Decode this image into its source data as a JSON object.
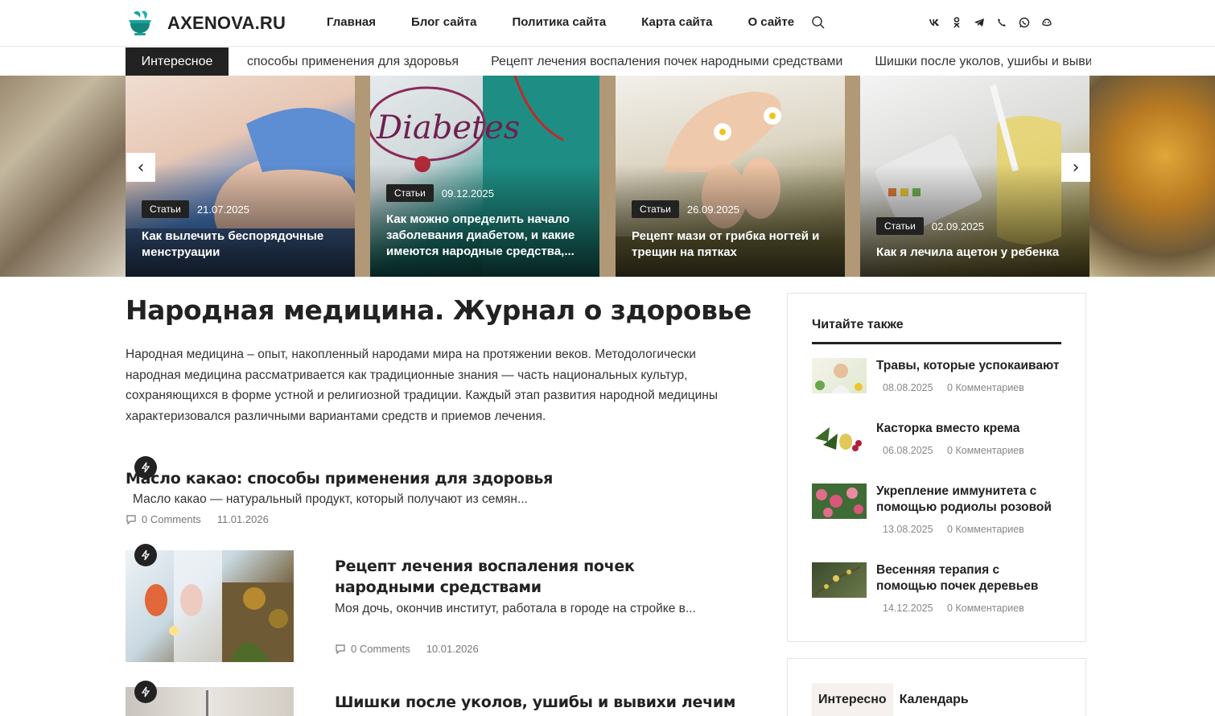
{
  "header": {
    "logo_text": "AXENOVA.RU",
    "nav": [
      "Главная",
      "Блог сайта",
      "Политика сайта",
      "Карта сайта",
      "О сайте"
    ],
    "social_icons": [
      "vk-icon",
      "odnoklassniki-icon",
      "telegram-icon",
      "viber-icon",
      "whatsapp-icon",
      "max-icon"
    ]
  },
  "ticker": {
    "label": "Интересное",
    "items": [
      "способы применения для здоровья",
      "Рецепт лечения воспаления почек народными средствами",
      "Шишки после уколов, ушибы и выви"
    ]
  },
  "slider": {
    "prev": "‹",
    "next": "›",
    "slides": [
      {
        "category": "Статьи",
        "date": "21.07.2025",
        "title": "Как вылечить беспорядочные менструации"
      },
      {
        "category": "Статьи",
        "date": "09.12.2025",
        "title": "Как можно определить начало заболевания диабетом, и какие имеются народные средства,..."
      },
      {
        "category": "Статьи",
        "date": "26.09.2025",
        "title": "Рецепт мази от грибка ногтей и трещин на пятках"
      },
      {
        "category": "Статьи",
        "date": "02.09.2025",
        "title": "Как я лечила ацетон у ребенка"
      }
    ]
  },
  "main": {
    "title": "Народная медицина. Журнал о здоровье",
    "intro": "Народная медицина – опыт, накопленный народами мира на протяжении веков. Методологически народная медицина рассматривается как традиционные знания — часть национальных культур, сохраняющихся в форме устной и религиозной традиции. Каждый этап развития народной медицины характеризовался различными вариантами средств и приемов лечения.",
    "posts": [
      {
        "title": "Масло какао: способы применения для здоровья",
        "excerpt": "Масло какао — натуральный продукт, который получают из семян...",
        "comments": "0 Comments",
        "date": "11.01.2026"
      },
      {
        "title": "Рецепт лечения воспаления почек народными средствами",
        "excerpt": "Моя дочь, окончив институт, работала в городе на стройке в...",
        "comments": "0 Comments",
        "date": "10.01.2026"
      },
      {
        "title": "Шишки после уколов, ушибы и вывихи лечим",
        "excerpt": "",
        "comments": "",
        "date": ""
      }
    ]
  },
  "sidebar": {
    "widget_title": "Читайте также",
    "items": [
      {
        "title": "Травы, которые успокаивают",
        "date": "08.08.2025",
        "comments": "0 Комментариев"
      },
      {
        "title": "Касторка вместо крема",
        "date": "06.08.2025",
        "comments": "0 Комментариев"
      },
      {
        "title": "Укрепление иммунитета с помощью родиолы розовой",
        "date": "13.08.2025",
        "comments": "0 Комментариев"
      },
      {
        "title": "Весенняя терапия с помощью почек деревьев",
        "date": "14.12.2025",
        "comments": "0 Комментариев"
      }
    ],
    "tabs": [
      "Интересно",
      "Календарь"
    ]
  },
  "colors": {
    "dark": "#222222",
    "logo_teal": "#1aa39a",
    "tab_active_bg": "#f6f1ef"
  }
}
